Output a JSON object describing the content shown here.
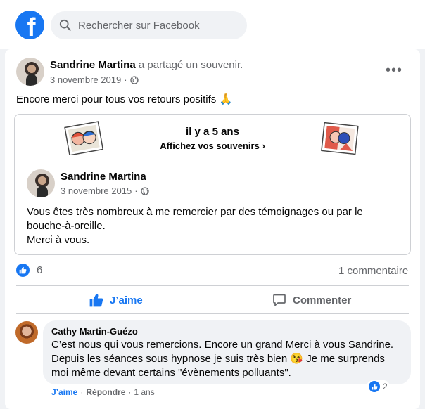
{
  "header": {
    "logo_letter": "f",
    "search_placeholder": "Rechercher sur Facebook",
    "brand_color": "#1877f2"
  },
  "post": {
    "author": "Sandrine Martina",
    "action": " a partagé un souvenir.",
    "date": "3 novembre 2019",
    "separator": " · ",
    "privacy_icon": "globe-icon",
    "menu_label": "•••",
    "text": "Encore merci pour tous vos retours positifs 🙏"
  },
  "memory": {
    "title": "il y a 5 ans",
    "subtitle": "Affichez vos souvenirs",
    "author": "Sandrine Martina",
    "date": "3 novembre 2015",
    "separator": " · ",
    "lines": [
      "Vous êtes très nombreux à me remercier par des témoignages ou par le bouche-à-oreille.",
      "Merci à vous."
    ]
  },
  "stats": {
    "reaction_count": "6",
    "comment_count": "1 commentaire"
  },
  "actions": {
    "like_label": "J’aime",
    "comment_label": "Commenter"
  },
  "comment": {
    "author": "Cathy Martin-Guézo",
    "text": "C’est nous qui vous remercions. Encore un grand Merci à vous Sandrine. Depuis les séances sous hypnose je suis très bien 😘 Je me surprends moi même devant certains \"évènements polluants\".",
    "reaction_count": "2",
    "like_label": "J’aime",
    "dot1": " · ",
    "reply_label": "Répondre",
    "dot2": " · ",
    "time": "1 ans"
  }
}
